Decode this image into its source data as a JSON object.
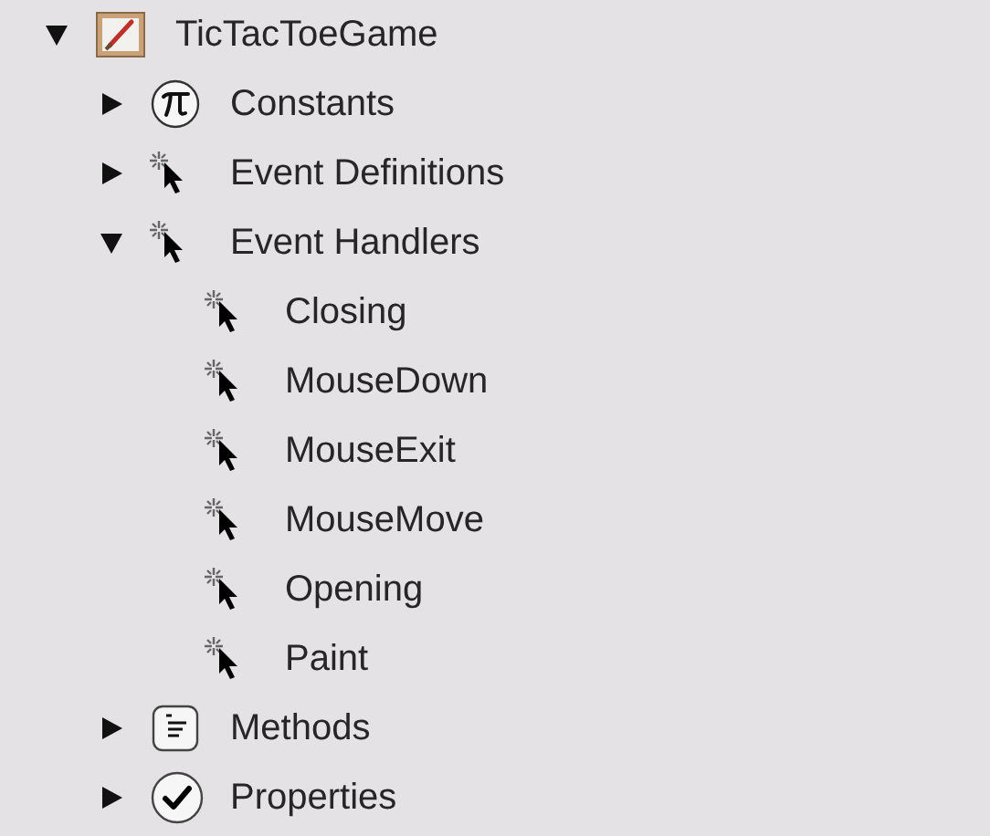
{
  "tree": [
    {
      "label": "TicTacToeGame",
      "kind": "window",
      "expanded": true,
      "children": [
        {
          "label": "Constants",
          "kind": "constant",
          "expanded": false
        },
        {
          "label": "Event Definitions",
          "kind": "event",
          "expanded": false
        },
        {
          "label": "Event Handlers",
          "kind": "event",
          "expanded": true,
          "children": [
            {
              "label": "Closing",
              "kind": "event"
            },
            {
              "label": "MouseDown",
              "kind": "event"
            },
            {
              "label": "MouseExit",
              "kind": "event"
            },
            {
              "label": "MouseMove",
              "kind": "event"
            },
            {
              "label": "Opening",
              "kind": "event"
            },
            {
              "label": "Paint",
              "kind": "event"
            }
          ]
        },
        {
          "label": "Methods",
          "kind": "method",
          "expanded": false
        },
        {
          "label": "Properties",
          "kind": "property",
          "expanded": false
        }
      ]
    }
  ]
}
